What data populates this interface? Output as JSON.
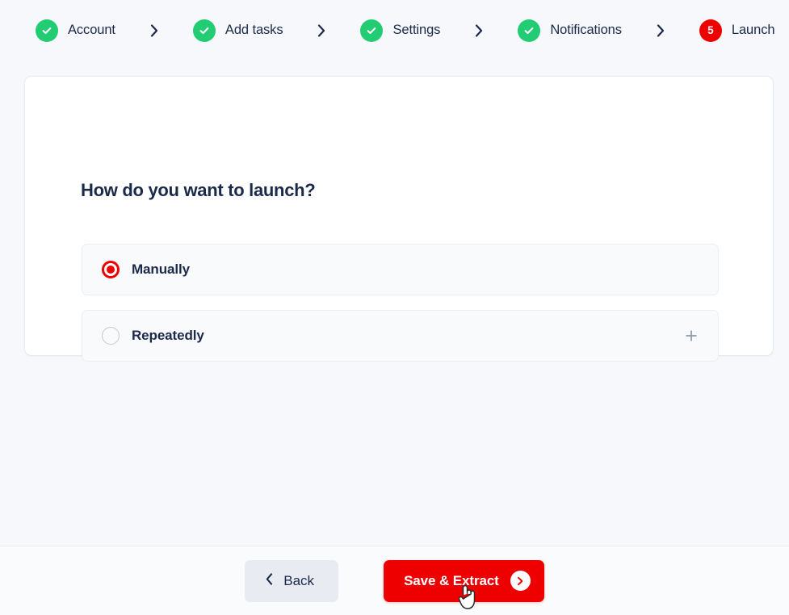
{
  "stepper": {
    "separator_icon": "chevron-right-icon",
    "steps": [
      {
        "label": "Account",
        "state": "done",
        "badge": "check-icon"
      },
      {
        "label": "Add tasks",
        "state": "done",
        "badge": "check-icon"
      },
      {
        "label": "Settings",
        "state": "done",
        "badge": "check-icon"
      },
      {
        "label": "Notifications",
        "state": "done",
        "badge": "check-icon"
      },
      {
        "label": "Launch",
        "state": "current",
        "badge": "5"
      }
    ]
  },
  "card": {
    "title": "How do you want to launch?",
    "options": [
      {
        "label": "Manually",
        "selected": true,
        "action_icon": ""
      },
      {
        "label": "Repeatedly",
        "selected": false,
        "action_icon": "plus-icon"
      }
    ]
  },
  "footer": {
    "back_label": "Back",
    "back_icon": "chevron-left-icon",
    "primary_label": "Save & Extract",
    "primary_icon": "chevron-right-circle-icon"
  },
  "colors": {
    "accent_red": "#ee0000",
    "success_green": "#21cc73",
    "text_navy": "#1b2a4a",
    "page_bg": "#f7f8fc",
    "card_bg": "#ffffff",
    "option_bg": "#f9fafc",
    "back_btn_bg": "#e9ebf2"
  },
  "cursor": {
    "type": "pointing-hand"
  }
}
